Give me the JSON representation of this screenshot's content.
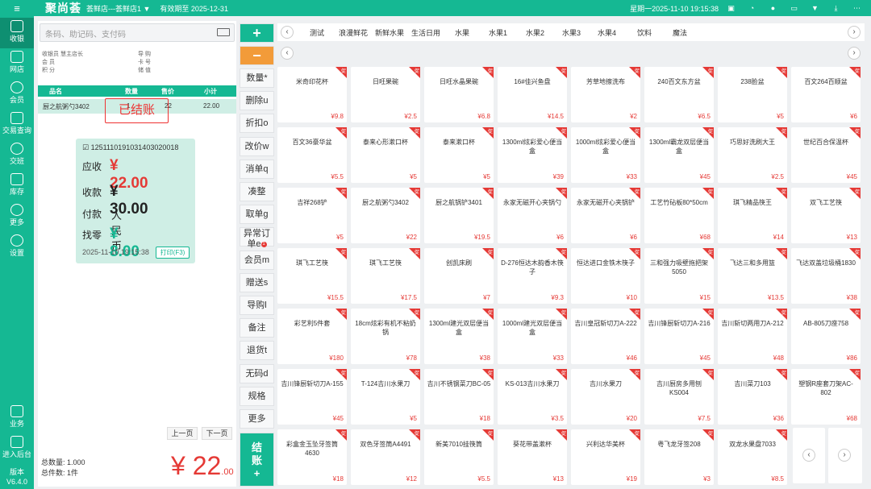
{
  "header": {
    "brand": "聚尚荟",
    "shop": "荟鲜店---荟鲜店1 ▼",
    "validity": "有效期至 2025-12-31",
    "datetime": "星期一2025-11-10 19:15:38"
  },
  "nav": [
    {
      "label": "收银"
    },
    {
      "label": "网店"
    },
    {
      "label": "会员"
    },
    {
      "label": "交易查询"
    },
    {
      "label": "交班"
    },
    {
      "label": "库存"
    },
    {
      "label": "更多"
    },
    {
      "label": "设置"
    },
    {
      "label": "业务"
    },
    {
      "label": "进入后台"
    }
  ],
  "version": {
    "label": "版本",
    "value": "V6.4.0"
  },
  "search": {
    "placeholder": "条码、助记码、支付码"
  },
  "info": {
    "l1": "收银员  慧主店长",
    "l2": "会    员",
    "l3": "积    分",
    "r1": "导    购",
    "r2": "卡    号",
    "r3": "储    值"
  },
  "table": {
    "headers": [
      "品名",
      "数量",
      "售价",
      "小计"
    ],
    "row": [
      "厨之航粥勺3402",
      "1",
      "22",
      "22.00"
    ]
  },
  "stamp": "已结账",
  "receipt": {
    "no": "1251110191031403020018",
    "due_label": "应收",
    "due": "¥ 22.00",
    "paid_label": "收款",
    "paid": "¥ 30.00",
    "method_label": "付款",
    "method": "人民币",
    "change_label": "找零",
    "change": "¥ 8.00",
    "date": "2025-11-10 19:15:38",
    "print": "打印(F3)"
  },
  "pager": {
    "prev": "上一页",
    "next": "下一页"
  },
  "totals": {
    "qty": "总数量: 1.000",
    "count": "总件数: 1件",
    "amount": "¥ 22",
    "cents": ".00"
  },
  "funcs": [
    "数量*",
    "删除u",
    "折扣o",
    "改价w",
    "消单q",
    "凑整",
    "取单g",
    "异常订单e",
    "会员m",
    "赠送s",
    "导购l",
    "备注",
    "退货t",
    "无码d",
    "规格",
    "更多"
  ],
  "pay": {
    "label": "结账",
    "plus": "+"
  },
  "badge": "1",
  "categories": [
    "测试",
    "浪漫鲜花",
    "新鲜水果",
    "生活日用",
    "水果",
    "水果1",
    "水果2",
    "水果3",
    "水果4",
    "饮料",
    "魔法"
  ],
  "promo": "促",
  "products": [
    {
      "n": "米奇印花杯",
      "p": "¥9.8"
    },
    {
      "n": "日旺果碗",
      "p": "¥2.5"
    },
    {
      "n": "日旺水晶果碗",
      "p": "¥6.8"
    },
    {
      "n": "16#佳兴鱼盘",
      "p": "¥14.5"
    },
    {
      "n": "芳草地擦洗布",
      "p": "¥2"
    },
    {
      "n": "240百文东方盆",
      "p": "¥6.5"
    },
    {
      "n": "238脸盆",
      "p": "¥5"
    },
    {
      "n": "百文264百顺盆",
      "p": "¥6"
    },
    {
      "n": "百文36豪华盆",
      "p": "¥5.5"
    },
    {
      "n": "泰来心形漱口杯",
      "p": "¥5"
    },
    {
      "n": "泰来漱口杯",
      "p": "¥5"
    },
    {
      "n": "1300ml炫彩爱心便当盒",
      "p": "¥39"
    },
    {
      "n": "1000ml炫彩爱心便当盒",
      "p": "¥33"
    },
    {
      "n": "1300ml霸龙双层便当盒",
      "p": "¥45"
    },
    {
      "n": "巧思好洗刷大王",
      "p": "¥2.5"
    },
    {
      "n": "世纪百合保温杯",
      "p": "¥45"
    },
    {
      "n": "吉祥268铲",
      "p": "¥5"
    },
    {
      "n": "厨之航粥勺3402",
      "p": "¥22"
    },
    {
      "n": "厨之航锅铲3401",
      "p": "¥19.5"
    },
    {
      "n": "永家无磁开心夹锅勺",
      "p": "¥6"
    },
    {
      "n": "永家无磁开心夹锅铲",
      "p": "¥6"
    },
    {
      "n": "工艺竹砧板80*50cm",
      "p": "¥68"
    },
    {
      "n": "琪飞精品筷王",
      "p": "¥14"
    },
    {
      "n": "双飞工艺筷",
      "p": "¥13"
    },
    {
      "n": "琪飞工艺筷",
      "p": "¥15.5"
    },
    {
      "n": "琪飞工艺筷",
      "p": "¥17.5"
    },
    {
      "n": "创凯床刷",
      "p": "¥7"
    },
    {
      "n": "D-276恒达木韵香木筷子",
      "p": "¥9.3"
    },
    {
      "n": "恒达进口金铁木筷子",
      "p": "¥10"
    },
    {
      "n": "三和强力吸壁拖把架5050",
      "p": "¥15"
    },
    {
      "n": "飞达三和多用篮",
      "p": "¥13.5"
    },
    {
      "n": "飞达双盖垃圾桶1830",
      "p": "¥38"
    },
    {
      "n": "彩艺利5件套",
      "p": "¥180"
    },
    {
      "n": "18cm炫彩有机不粘奶锅",
      "p": "¥78"
    },
    {
      "n": "1300ml建光双层便当盒",
      "p": "¥38"
    },
    {
      "n": "1000ml建光双层便当盒",
      "p": "¥33"
    },
    {
      "n": "吉川皇冠斩切刀A-222",
      "p": "¥46"
    },
    {
      "n": "吉川锋厨斩切刀A-216",
      "p": "¥45"
    },
    {
      "n": "吉川斩切两用刀A-212",
      "p": "¥48"
    },
    {
      "n": "AB-805刀座758",
      "p": "¥86"
    },
    {
      "n": "吉川锋厨斩切刀A-155",
      "p": "¥45"
    },
    {
      "n": "T-124吉川水果刀",
      "p": "¥5"
    },
    {
      "n": "吉川不锈钢菜刀BC-05",
      "p": "¥18"
    },
    {
      "n": "KS-013吉川水果刀",
      "p": "¥3.5"
    },
    {
      "n": "吉川水果刀",
      "p": "¥20"
    },
    {
      "n": "吉川厨房多用刨KS004",
      "p": "¥7.5"
    },
    {
      "n": "吉川菜刀103",
      "p": "¥36"
    },
    {
      "n": "塑钢R座套刀架AC-802",
      "p": "¥68"
    },
    {
      "n": "彩盒金玉坠牙签筒4630",
      "p": "¥18"
    },
    {
      "n": "双色牙签筒A4491",
      "p": "¥12"
    },
    {
      "n": "新美7010挂筷筒",
      "p": "¥5.5"
    },
    {
      "n": "葵花带盖漱杯",
      "p": "¥13"
    },
    {
      "n": "兴利达华美杯",
      "p": "¥19"
    },
    {
      "n": "粤飞龙牙签208",
      "p": "¥3"
    },
    {
      "n": "双龙水果盘7033",
      "p": "¥8.5"
    }
  ]
}
